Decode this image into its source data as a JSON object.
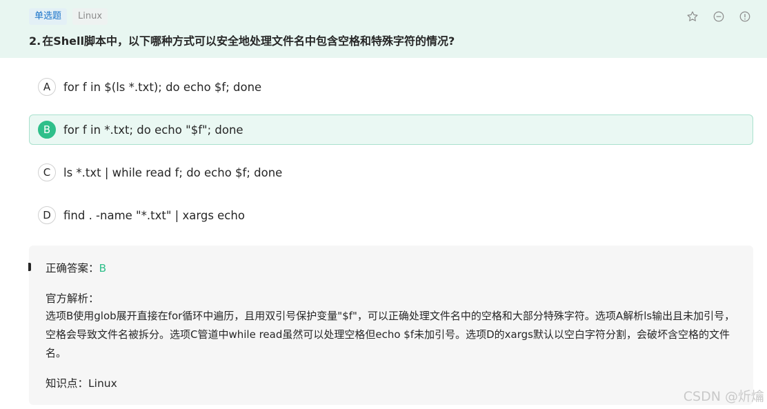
{
  "header": {
    "tag_type": "单选题",
    "tag_topic": "Linux",
    "question_number": "2.",
    "question_text": "在Shell脚本中，以下哪种方式可以安全地处理文件名中包含空格和特殊字符的情况?",
    "icons": [
      "star-icon",
      "minus-circle-icon",
      "info-circle-icon"
    ]
  },
  "options": [
    {
      "letter": "A",
      "text": "for f in $(ls *.txt); do echo $f; done",
      "selected": false
    },
    {
      "letter": "B",
      "text": "for f in *.txt; do echo \"$f\"; done",
      "selected": true
    },
    {
      "letter": "C",
      "text": "ls *.txt | while read f; do echo $f; done",
      "selected": false
    },
    {
      "letter": "D",
      "text": "find . -name \"*.txt\" | xargs echo",
      "selected": false
    }
  ],
  "analysis": {
    "answer_label": "正确答案：",
    "answer_value": "B",
    "explain_label": "官方解析：",
    "explain_text": "选项B使用glob展开直接在for循环中遍历，且用双引号保护变量\"$f\"，可以正确处理文件名中的空格和大部分特殊字符。选项A解析ls输出且未加引号，空格会导致文件名被拆分。选项C管道中while read虽然可以处理空格但echo $f未加引号。选项D的xargs默认以空白字符分割，会破坏含空格的文件名。",
    "knowledge_label": "知识点：",
    "knowledge_value": "Linux"
  },
  "watermark": "CSDN @炘爚",
  "colors": {
    "accent": "#2fbf8a",
    "header_bg": "#e8f6f1",
    "selected_bg": "#eaf8f3",
    "tag_type": "#1a73c9"
  }
}
